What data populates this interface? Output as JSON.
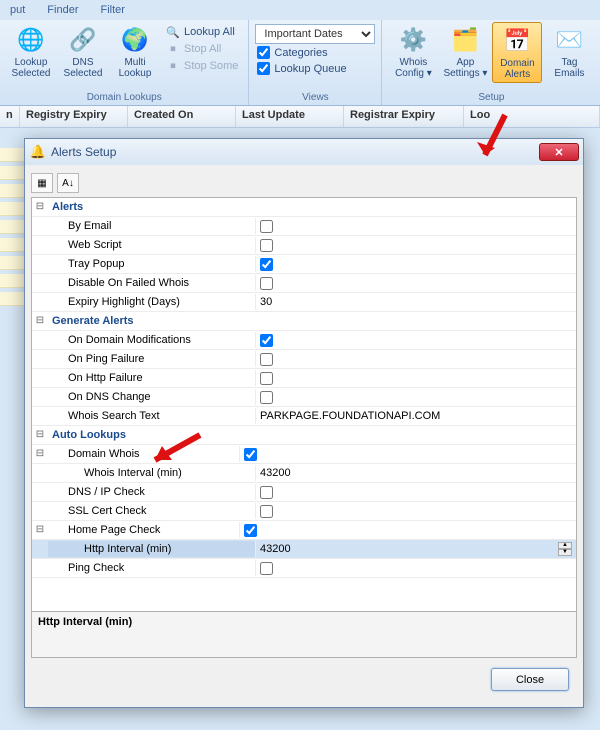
{
  "ribbon_tabs": {
    "t0": "put",
    "t1": "Finder",
    "t2": "Filter"
  },
  "groups": {
    "domain_lookups": {
      "label": "Domain Lookups",
      "lookup_selected": "Lookup\nSelected",
      "dns_selected": "DNS\nSelected",
      "multi_lookup": "Multi\nLookup",
      "lookup_all": "Lookup All",
      "stop_all": "Stop All",
      "stop_some": "Stop Some"
    },
    "views": {
      "label": "Views",
      "combo": "Important Dates",
      "categories": "Categories",
      "lookup_queue": "Lookup Queue"
    },
    "setup": {
      "label": "Setup",
      "whois_config": "Whois\nConfig",
      "app_settings": "App\nSettings",
      "domain_alerts": "Domain\nAlerts",
      "tag_emails": "Tag\nEmails"
    }
  },
  "columns": {
    "c0": "n",
    "c1": "Registry Expiry",
    "c2": "Created On",
    "c3": "Last Update",
    "c4": "Registrar Expiry",
    "c5": "Loo"
  },
  "dialog": {
    "title": "Alerts Setup",
    "close": "Close",
    "desc_title": "Http Interval (min)",
    "categories": {
      "alerts": "Alerts",
      "generate": "Generate Alerts",
      "auto": "Auto Lookups"
    },
    "props": {
      "by_email": "By Email",
      "web_script": "Web Script",
      "tray_popup": "Tray Popup",
      "disable_failed": "Disable On Failed Whois",
      "expiry_highlight": "Expiry Highlight (Days)",
      "expiry_highlight_val": "30",
      "on_domain_mod": "On Domain Modifications",
      "on_ping_fail": "On Ping Failure",
      "on_http_fail": "On Http Failure",
      "on_dns_change": "On DNS Change",
      "whois_search_text": "Whois Search Text",
      "whois_search_val": "PARKPAGE.FOUNDATIONAPI.COM",
      "domain_whois": "Domain Whois",
      "whois_interval": "Whois Interval (min)",
      "whois_interval_val": "43200",
      "dns_ip_check": "DNS / IP Check",
      "ssl_cert": "SSL Cert Check",
      "home_page": "Home Page Check",
      "http_interval": "Http Interval (min)",
      "http_interval_val": "43200",
      "ping_check": "Ping Check"
    }
  }
}
